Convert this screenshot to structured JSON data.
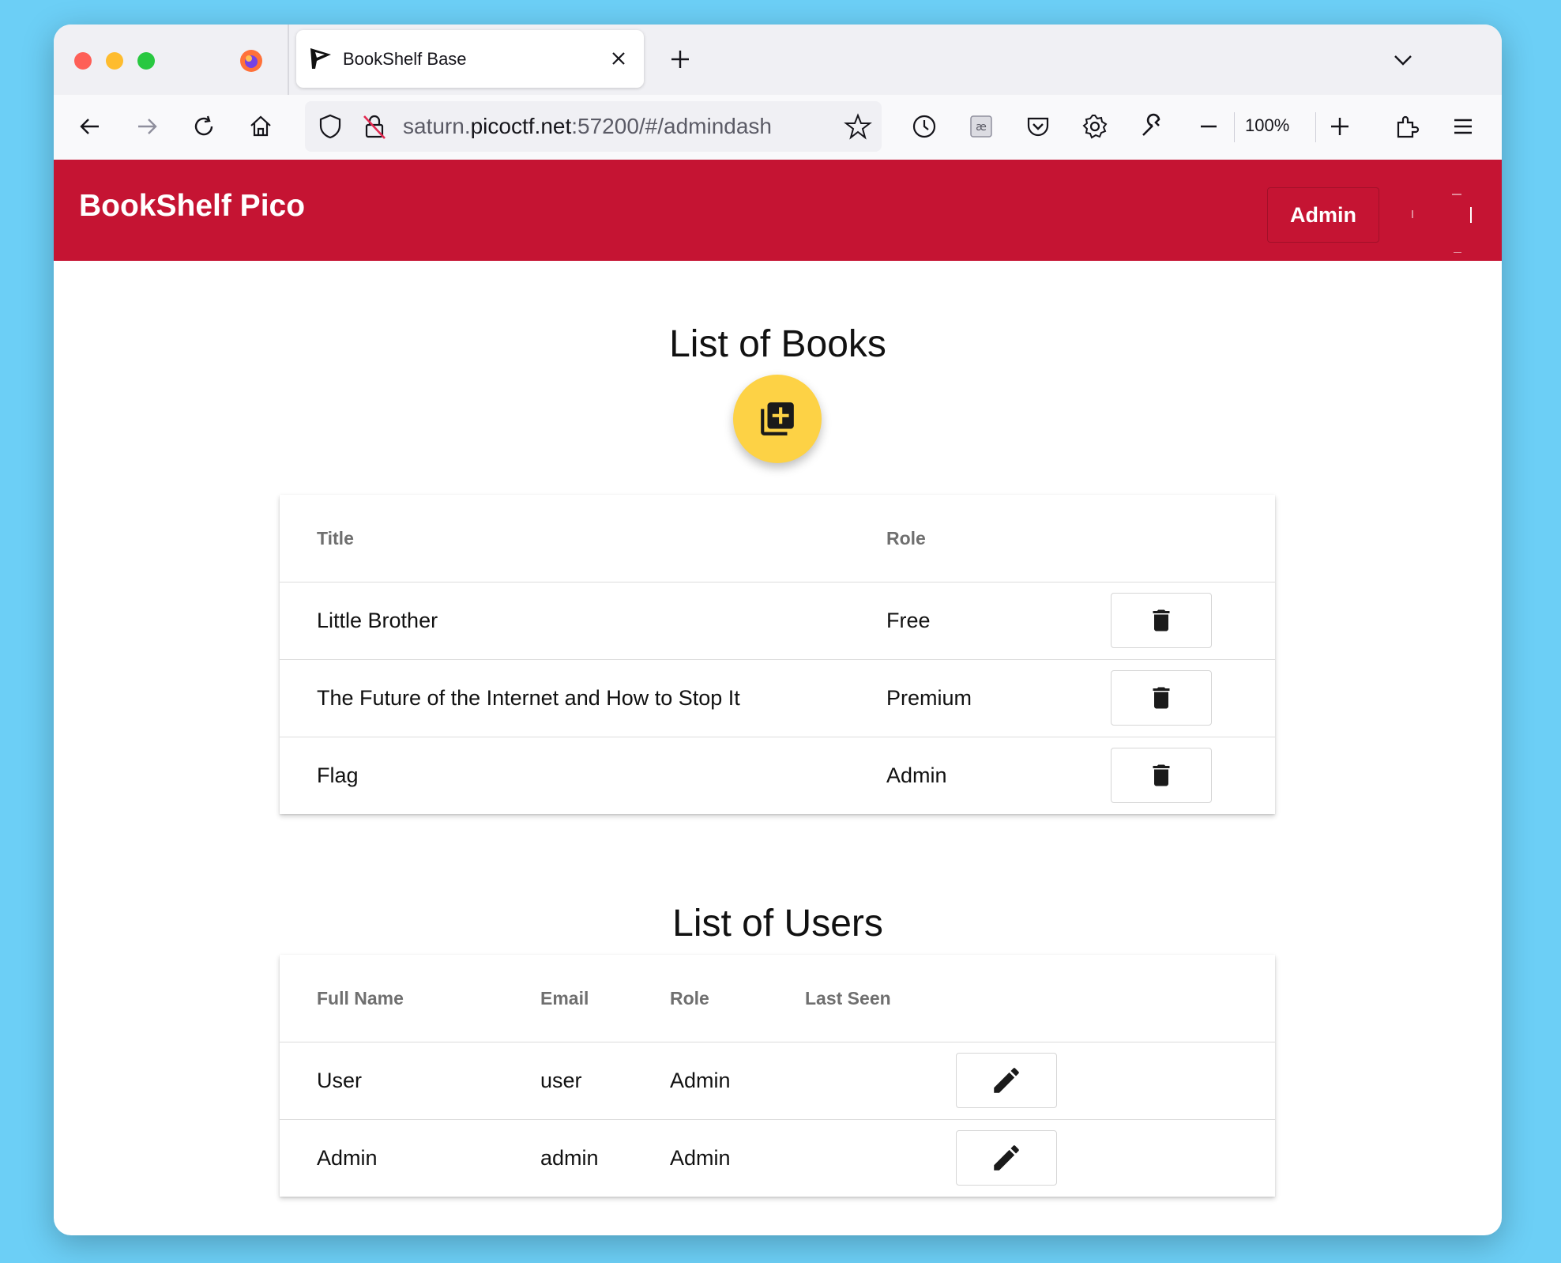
{
  "browser": {
    "tab_title": "BookShelf Base",
    "url_prefix": "saturn.",
    "url_host": "picoctf.net",
    "url_suffix": ":57200/#/admindash",
    "zoom": "100%"
  },
  "app": {
    "brand": "BookShelf Pico",
    "admin_button": "Admin",
    "accent_color": "#c51433",
    "fab_color": "#fdd245"
  },
  "books": {
    "heading": "List of Books",
    "columns": {
      "title": "Title",
      "role": "Role"
    },
    "rows": [
      {
        "title": "Little Brother",
        "role": "Free"
      },
      {
        "title": "The Future of the Internet and How to Stop It",
        "role": "Premium"
      },
      {
        "title": "Flag",
        "role": "Admin"
      }
    ]
  },
  "users": {
    "heading": "List of Users",
    "columns": {
      "full_name": "Full Name",
      "email": "Email",
      "role": "Role",
      "last_seen": "Last Seen"
    },
    "rows": [
      {
        "full_name": "User",
        "email": "user",
        "role": "Admin",
        "last_seen": ""
      },
      {
        "full_name": "Admin",
        "email": "admin",
        "role": "Admin",
        "last_seen": ""
      }
    ]
  }
}
